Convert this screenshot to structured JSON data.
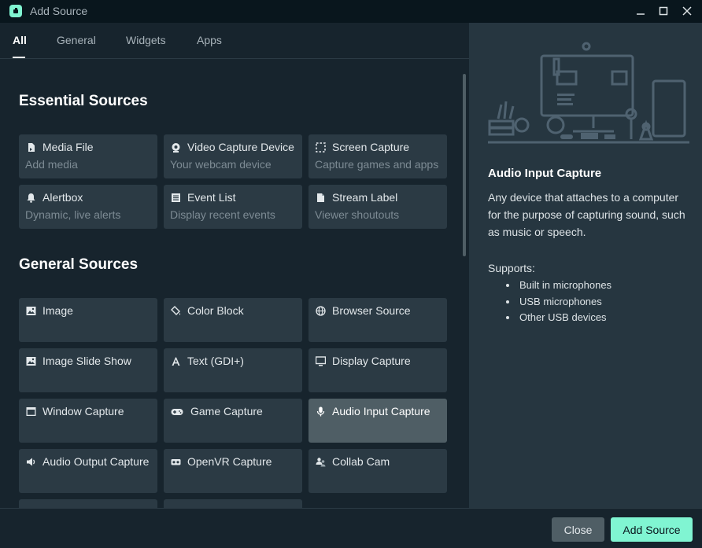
{
  "window": {
    "title": "Add Source"
  },
  "tabs": [
    {
      "label": "All"
    },
    {
      "label": "General"
    },
    {
      "label": "Widgets"
    },
    {
      "label": "Apps"
    }
  ],
  "essential": {
    "title": "Essential Sources",
    "cards": [
      {
        "name": "Media File",
        "desc": "Add media",
        "icon": "file-icon"
      },
      {
        "name": "Video Capture Device",
        "desc": "Your webcam device",
        "icon": "webcam-icon"
      },
      {
        "name": "Screen Capture",
        "desc": "Capture games and apps",
        "icon": "screen-select-icon"
      },
      {
        "name": "Alertbox",
        "desc": "Dynamic, live alerts",
        "icon": "bell-icon"
      },
      {
        "name": "Event List",
        "desc": "Display recent events",
        "icon": "list-icon"
      },
      {
        "name": "Stream Label",
        "desc": "Viewer shoutouts",
        "icon": "document-icon"
      }
    ]
  },
  "general": {
    "title": "General Sources",
    "cards": [
      {
        "name": "Image",
        "icon": "image-icon"
      },
      {
        "name": "Color Block",
        "icon": "paint-bucket-icon"
      },
      {
        "name": "Browser Source",
        "icon": "globe-icon"
      },
      {
        "name": "Image Slide Show",
        "icon": "image-icon"
      },
      {
        "name": "Text (GDI+)",
        "icon": "text-icon"
      },
      {
        "name": "Display Capture",
        "icon": "monitor-icon"
      },
      {
        "name": "Window Capture",
        "icon": "window-icon"
      },
      {
        "name": "Game Capture",
        "icon": "gamepad-icon"
      },
      {
        "name": "Audio Input Capture",
        "icon": "microphone-icon",
        "selected": true
      },
      {
        "name": "Audio Output Capture",
        "icon": "speaker-icon"
      },
      {
        "name": "OpenVR Capture",
        "icon": "vr-headset-icon"
      },
      {
        "name": "Collab Cam",
        "icon": "users-icon"
      }
    ]
  },
  "details": {
    "title": "Audio Input Capture",
    "description": "Any device that attaches to a computer for the purpose of capturing sound, such as music or speech.",
    "supports_label": "Supports:",
    "supports": [
      "Built in microphones",
      "USB microphones",
      "Other USB devices"
    ]
  },
  "footer": {
    "close_label": "Close",
    "add_label": "Add Source"
  },
  "colors": {
    "accent": "#80f5d2",
    "background": "#17242d",
    "card": "#2b3a44",
    "panel": "#263640",
    "selected": "#4f5e65"
  }
}
